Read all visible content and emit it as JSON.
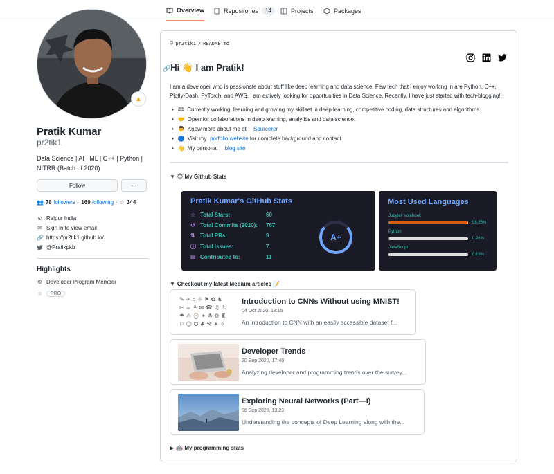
{
  "tabs": [
    {
      "label": "Overview",
      "icon": "book-icon",
      "active": true
    },
    {
      "label": "Repositories",
      "icon": "repo-icon",
      "count": "14"
    },
    {
      "label": "Projects",
      "icon": "project-icon"
    },
    {
      "label": "Packages",
      "icon": "package-icon"
    }
  ],
  "profile": {
    "name": "Pratik Kumar",
    "login": "pr2tik1",
    "bio": "Data Science | AI | ML | C++ | Python | NITRR (Batch of 2020)",
    "follow_label": "Follow",
    "more_label": "···",
    "followers_count": "78",
    "followers_label": "followers",
    "following_count": "169",
    "following_label": "following",
    "stars_count": "344",
    "location": "Raipur India",
    "email": "Sign in to view email",
    "website": "https://pr2tik1.github.io/",
    "twitter": "@Pratikpkb",
    "highlights_title": "Highlights",
    "highlights_item": "Developer Program Member",
    "pro_badge": "PRO"
  },
  "readme": {
    "path_user": "pr2tik1",
    "path_sep": "/",
    "path_file": "README.md",
    "greeting": "Hi 👋 I am Pratik!",
    "intro": "I am a developer who is passionate about stuff like deep learning and data science. Few tech that I enjoy working in are Python, C++, Plotly-Dash, PyTorch, and AWS. I am actively looking for opportunities in Data Science. Recently, I have just started with tech-blogging!",
    "bullets": [
      {
        "emoji": "🕮",
        "text": "Currently working, learning and growing my skillset in deep learning, competitive coding, data structures and algorithms."
      },
      {
        "emoji": "🤝",
        "text": "Open for collaborations in deep learning, analytics and data science."
      },
      {
        "emoji": "👨",
        "text": "Know more about me at ",
        "link": "Sourcerer"
      },
      {
        "emoji": "🔵",
        "text": "Visit my ",
        "link": "porfolio website",
        "after": " for complete background and contact."
      },
      {
        "emoji": "👋",
        "text": "My personal ",
        "link": "blog site"
      }
    ],
    "stats_summary": "😇 My Github Stats",
    "articles_summary": "Checkout my latest Medium articles 📝",
    "programming_summary": "🤖 My programming stats"
  },
  "github_stats": {
    "title": "Pratik Kumar's GitHub Stats",
    "rows": [
      {
        "icon": "star-icon",
        "glyph": "☆",
        "label": "Total Stars:",
        "value": "60"
      },
      {
        "icon": "history-icon",
        "glyph": "↺",
        "label": "Total Commits (2020):",
        "value": "767"
      },
      {
        "icon": "pr-icon",
        "glyph": "⇅",
        "label": "Total PRs:",
        "value": "9"
      },
      {
        "icon": "issue-icon",
        "glyph": "ⓘ",
        "label": "Total Issues:",
        "value": "7"
      },
      {
        "icon": "repo-icon",
        "glyph": "▤",
        "label": "Contributed to:",
        "value": "11"
      }
    ],
    "grade": "A+",
    "colors": {
      "bg": "#1a1b27",
      "title": "#70a5fd",
      "text": "#38bdae",
      "icon": "#bf91f3",
      "ring": "#70a5fd"
    }
  },
  "languages": {
    "title": "Most Used Languages",
    "items": [
      {
        "name": "Jupyter Notebook",
        "percent": 98.85,
        "pct_label": "98.85%",
        "color": "#DA5B0B"
      },
      {
        "name": "Python",
        "percent": 0.96,
        "pct_label": "0.96%",
        "color": "#3572A5"
      },
      {
        "name": "JavaScript",
        "percent": 0.19,
        "pct_label": "0.19%",
        "color": "#f1e05a"
      }
    ]
  },
  "articles": [
    {
      "title": "Introduction to CNNs Without using MNIST!",
      "date": "04 Oct 2020, 18:15",
      "desc": "An introduction to CNN with an easily accessible dataset f...",
      "thumb": "sketch-grid"
    },
    {
      "title": "Developer Trends",
      "date": "20 Sep 2020, 17:40",
      "desc": "Analyzing developer and programming trends over the survey...",
      "thumb": "laptop-photo"
    },
    {
      "title": "Exploring Neural Networks (Part—I)",
      "date": "06 Sep 2020, 13:23",
      "desc": "Understanding the concepts of Deep Learning along with the...",
      "thumb": "mountain-photo"
    }
  ]
}
